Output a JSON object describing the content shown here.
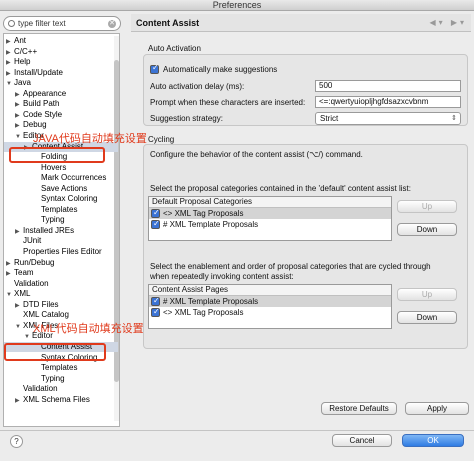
{
  "window": {
    "title": "Preferences"
  },
  "filter": {
    "value": "type filter text"
  },
  "tree": {
    "items": [
      {
        "label": "Ant",
        "arrow": "▶"
      },
      {
        "label": "C/C++",
        "arrow": "▶"
      },
      {
        "label": "Help",
        "arrow": "▶"
      },
      {
        "label": "Install/Update",
        "arrow": "▶"
      },
      {
        "label": "Java",
        "arrow": "▼"
      },
      {
        "label": "Appearance",
        "arrow": "▶"
      },
      {
        "label": "Build Path",
        "arrow": "▶"
      },
      {
        "label": "Code Style",
        "arrow": "▶"
      },
      {
        "label": "Debug",
        "arrow": "▶"
      },
      {
        "label": "Editor",
        "arrow": "▼"
      },
      {
        "label": "Content Assist",
        "arrow": "▶"
      },
      {
        "label": "Folding",
        "arrow": ""
      },
      {
        "label": "Hovers",
        "arrow": ""
      },
      {
        "label": "Mark Occurrences",
        "arrow": ""
      },
      {
        "label": "Save Actions",
        "arrow": ""
      },
      {
        "label": "Syntax Coloring",
        "arrow": ""
      },
      {
        "label": "Templates",
        "arrow": ""
      },
      {
        "label": "Typing",
        "arrow": ""
      },
      {
        "label": "Installed JREs",
        "arrow": "▶"
      },
      {
        "label": "JUnit",
        "arrow": ""
      },
      {
        "label": "Properties Files Editor",
        "arrow": ""
      },
      {
        "label": "Run/Debug",
        "arrow": "▶"
      },
      {
        "label": "Team",
        "arrow": "▶"
      },
      {
        "label": "Validation",
        "arrow": ""
      },
      {
        "label": "XML",
        "arrow": "▼"
      },
      {
        "label": "DTD Files",
        "arrow": "▶"
      },
      {
        "label": "XML Catalog",
        "arrow": ""
      },
      {
        "label": "XML Files",
        "arrow": "▼"
      },
      {
        "label": "Editor",
        "arrow": "▼"
      },
      {
        "label": "Content Assist",
        "arrow": ""
      },
      {
        "label": "Syntax Coloring",
        "arrow": ""
      },
      {
        "label": "Templates",
        "arrow": ""
      },
      {
        "label": "Typing",
        "arrow": ""
      },
      {
        "label": "Validation",
        "arrow": ""
      },
      {
        "label": "XML Schema Files",
        "arrow": "▶"
      }
    ]
  },
  "annotations": {
    "java": "JAVA代码自动填充设置",
    "xml": "XML代码自动填充设置"
  },
  "page": {
    "title": "Content Assist",
    "auto_activation": {
      "group_label": "Auto Activation",
      "enable_label": "Automatically make suggestions",
      "delay_label": "Auto activation delay (ms):",
      "delay_value": "500",
      "trigger_label": "Prompt when these characters are inserted:",
      "trigger_value": "<=:qwertyuiopljhgfdsazxcvbnm",
      "strategy_label": "Suggestion strategy:",
      "strategy_value": "Strict"
    },
    "cycling": {
      "group_label": "Cycling",
      "description": "Configure the behavior of the content assist (⌥/) command.",
      "default_desc": "Select the proposal categories contained in the 'default' content assist list:",
      "default_header": "Default Proposal Categories",
      "default_items": [
        "<> XML Tag Proposals",
        "# XML Template Proposals"
      ],
      "cycle_desc_1": "Select the enablement and order of proposal categories that are cycled through",
      "cycle_desc_2": "when repeatedly invoking content assist:",
      "cycle_header": "Content Assist Pages",
      "cycle_items": [
        "# XML Template Proposals",
        "<> XML Tag Proposals"
      ],
      "up_label": "Up",
      "down_label": "Down"
    },
    "restore_label": "Restore Defaults",
    "apply_label": "Apply"
  },
  "footer": {
    "help": "?",
    "cancel_label": "Cancel",
    "ok_label": "OK"
  }
}
